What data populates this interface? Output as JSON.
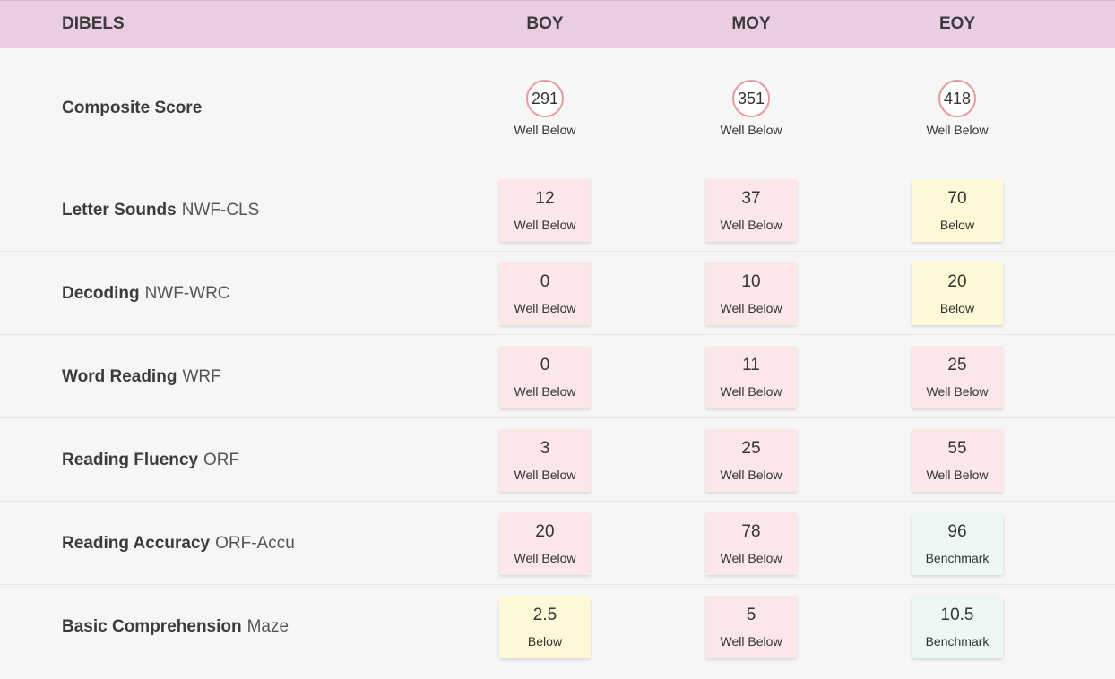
{
  "header": {
    "title": "DIBELS",
    "columns": [
      "BOY",
      "MOY",
      "EOY"
    ]
  },
  "colors": {
    "well_below": "#fbe7e8",
    "below": "#fdf8d6",
    "benchmark": "#edf8f2",
    "header_bg": "#e9cde3",
    "circle_border": "#e69a9a"
  },
  "composite": {
    "label": "Composite Score",
    "scores": [
      {
        "value": "291",
        "level": "Well Below"
      },
      {
        "value": "351",
        "level": "Well Below"
      },
      {
        "value": "418",
        "level": "Well Below"
      }
    ]
  },
  "rows": [
    {
      "name": "Letter Sounds",
      "code": "NWF-CLS",
      "scores": [
        {
          "value": "12",
          "level": "Well Below"
        },
        {
          "value": "37",
          "level": "Well Below"
        },
        {
          "value": "70",
          "level": "Below"
        }
      ]
    },
    {
      "name": "Decoding",
      "code": "NWF-WRC",
      "scores": [
        {
          "value": "0",
          "level": "Well Below"
        },
        {
          "value": "10",
          "level": "Well Below"
        },
        {
          "value": "20",
          "level": "Below"
        }
      ]
    },
    {
      "name": "Word Reading",
      "code": "WRF",
      "scores": [
        {
          "value": "0",
          "level": "Well Below"
        },
        {
          "value": "11",
          "level": "Well Below"
        },
        {
          "value": "25",
          "level": "Well Below"
        }
      ]
    },
    {
      "name": "Reading Fluency",
      "code": "ORF",
      "scores": [
        {
          "value": "3",
          "level": "Well Below"
        },
        {
          "value": "25",
          "level": "Well Below"
        },
        {
          "value": "55",
          "level": "Well Below"
        }
      ]
    },
    {
      "name": "Reading Accuracy",
      "code": "ORF-Accu",
      "scores": [
        {
          "value": "20",
          "level": "Well Below"
        },
        {
          "value": "78",
          "level": "Well Below"
        },
        {
          "value": "96",
          "level": "Benchmark"
        }
      ]
    },
    {
      "name": "Basic Comprehension",
      "code": "Maze",
      "scores": [
        {
          "value": "2.5",
          "level": "Below"
        },
        {
          "value": "5",
          "level": "Well Below"
        },
        {
          "value": "10.5",
          "level": "Benchmark"
        }
      ]
    }
  ]
}
